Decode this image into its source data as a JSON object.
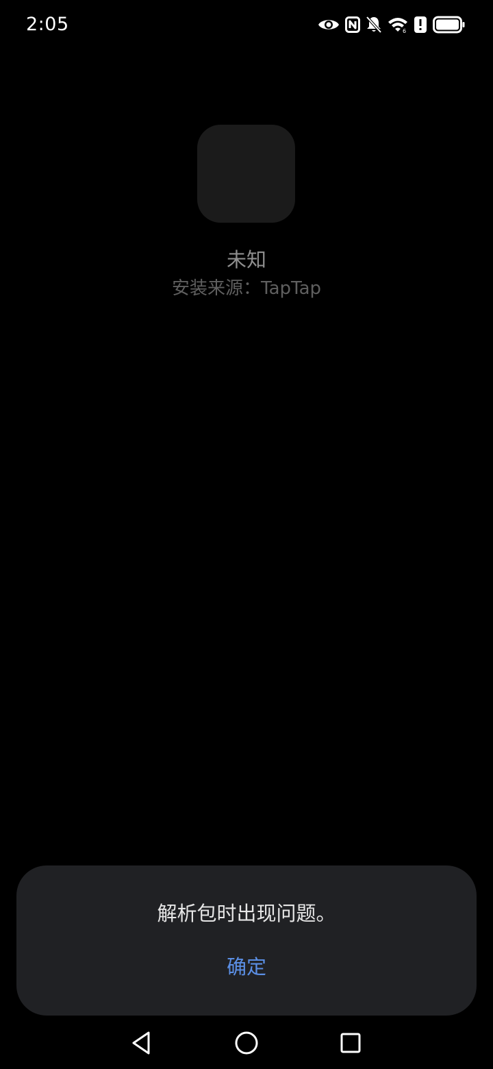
{
  "status_bar": {
    "time": "2:05",
    "icons": [
      "eye-icon",
      "nfc-icon",
      "bell-off-icon",
      "wifi-icon",
      "alert-icon",
      "battery-icon"
    ]
  },
  "app": {
    "name": "未知",
    "install_source": "安装来源：TapTap"
  },
  "dialog": {
    "message": "解析包时出现问题。",
    "confirm_label": "确定"
  },
  "nav_bar": {
    "icons": [
      "back-icon",
      "home-icon",
      "recents-icon"
    ]
  },
  "colors": {
    "background": "#000000",
    "dialog_background": "#202124",
    "accent": "#5b8fe5",
    "app_icon_placeholder": "#1b1b1b"
  }
}
